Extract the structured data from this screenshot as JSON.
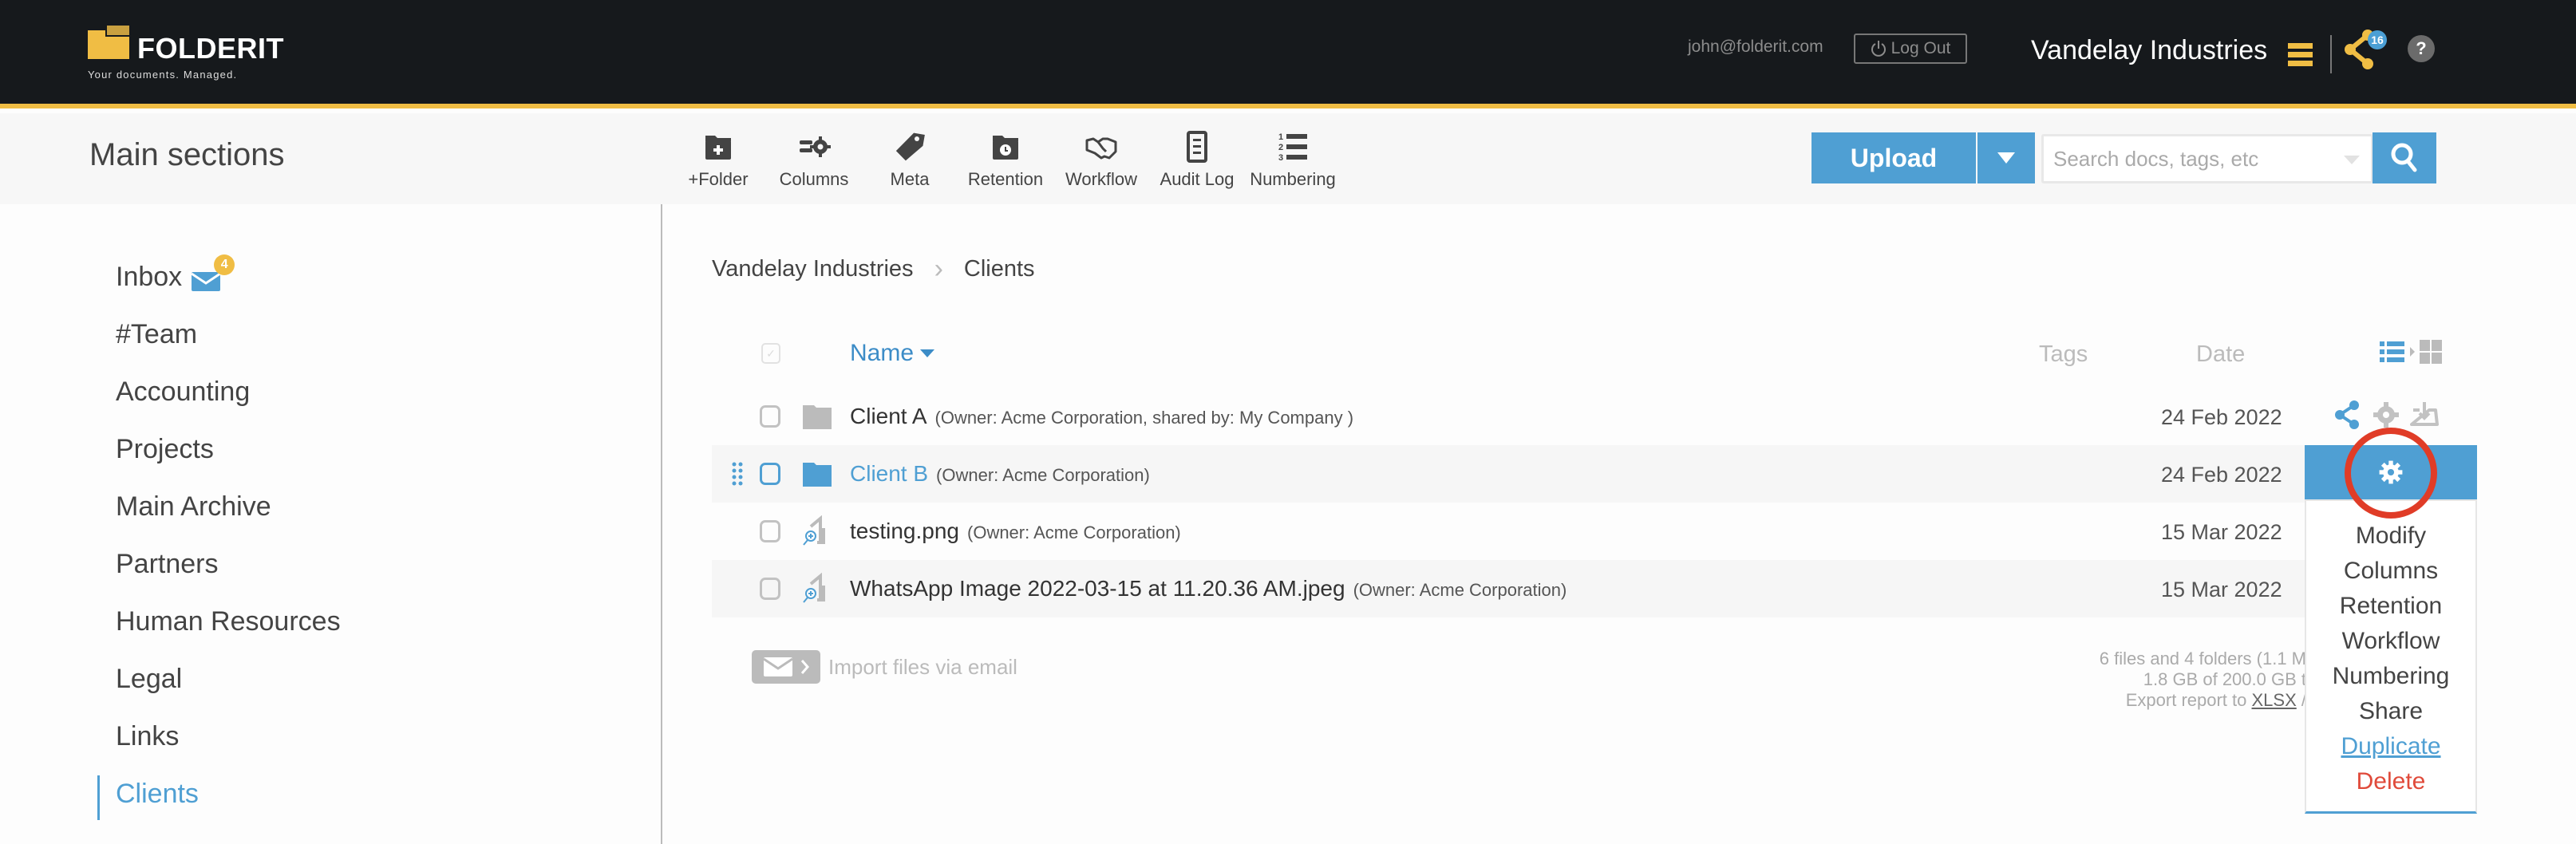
{
  "brand": {
    "name": "FOLDERIT",
    "tagline": "Your documents. Managed.",
    "accent_color": "#f0bd44",
    "primary_color": "#4f9fd3"
  },
  "topbar": {
    "user_email": "john@folderit.com",
    "logout_label": "Log Out",
    "org_name": "Vandelay Industries",
    "shared_count": "16",
    "help_label": "?"
  },
  "subheader": {
    "title": "Main sections",
    "toolbar": [
      {
        "label": "+Folder",
        "icon": "folder-plus-icon"
      },
      {
        "label": "Columns",
        "icon": "columns-settings-icon"
      },
      {
        "label": "Meta",
        "icon": "tag-icon"
      },
      {
        "label": "Retention",
        "icon": "folder-clock-icon"
      },
      {
        "label": "Workflow",
        "icon": "handshake-icon"
      },
      {
        "label": "Audit Log",
        "icon": "document-list-icon"
      },
      {
        "label": "Numbering",
        "icon": "numbered-list-icon"
      }
    ],
    "upload_label": "Upload",
    "search_placeholder": "Search docs, tags, etc"
  },
  "sidebar": {
    "items": [
      {
        "label": "Inbox",
        "badge": "4"
      },
      {
        "label": "#Team"
      },
      {
        "label": "Accounting"
      },
      {
        "label": "Projects"
      },
      {
        "label": "Main Archive"
      },
      {
        "label": "Partners"
      },
      {
        "label": "Human Resources"
      },
      {
        "label": "Legal"
      },
      {
        "label": "Links"
      },
      {
        "label": "Clients",
        "active": true
      }
    ]
  },
  "breadcrumb": [
    "Vandelay Industries",
    "Clients"
  ],
  "table": {
    "columns": {
      "name": "Name",
      "tags": "Tags",
      "date": "Date"
    },
    "rows": [
      {
        "type": "folder",
        "name": "Client A",
        "owner": "(Owner: Acme Corporation, shared by: My Company )",
        "date": "24 Feb 2022"
      },
      {
        "type": "folder",
        "name": "Client B",
        "owner": "(Owner: Acme Corporation)",
        "date": "24 Feb 2022",
        "hovered": true
      },
      {
        "type": "image",
        "name": "testing.png",
        "owner": "(Owner: Acme Corporation)",
        "date": "15 Mar 2022"
      },
      {
        "type": "image",
        "name": "WhatsApp Image 2022-03-15 at 11.20.36 AM.jpeg",
        "owner": "(Owner: Acme Corporation)",
        "date": "15 Mar 2022"
      }
    ]
  },
  "import_email_label": "Import files via email",
  "footer": {
    "files_summary": "6 files and 4 folders (1.1 M",
    "storage": "1.8 GB of 200.0 GB t",
    "export_prefix": "Export report to ",
    "export_xlsx": "XLSX",
    "export_suffix": " /"
  },
  "context_menu": {
    "items": [
      "Modify",
      "Columns",
      "Retention",
      "Workflow",
      "Numbering",
      "Share",
      "Duplicate",
      "Delete"
    ]
  }
}
